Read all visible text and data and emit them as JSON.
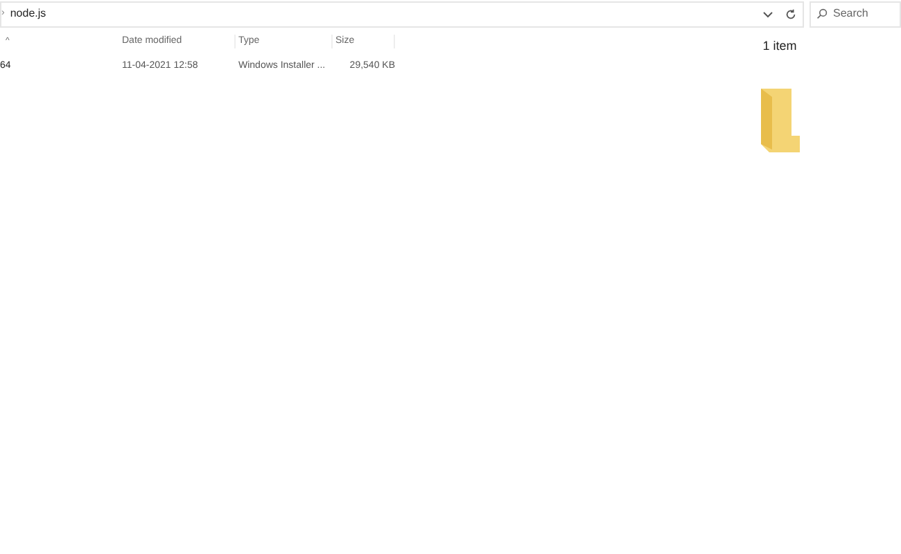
{
  "address_bar": {
    "separator": "›",
    "path": "node.js"
  },
  "search": {
    "placeholder": "Search"
  },
  "table": {
    "sort_indicator": "^",
    "columns": [
      "Date modified",
      "Type",
      "Size"
    ],
    "rows": [
      {
        "name": "64",
        "date": "11-04-2021 12:58",
        "type": "Windows Installer ...",
        "size": "29,540 KB"
      }
    ]
  },
  "details_pane": {
    "count": "1 item"
  }
}
